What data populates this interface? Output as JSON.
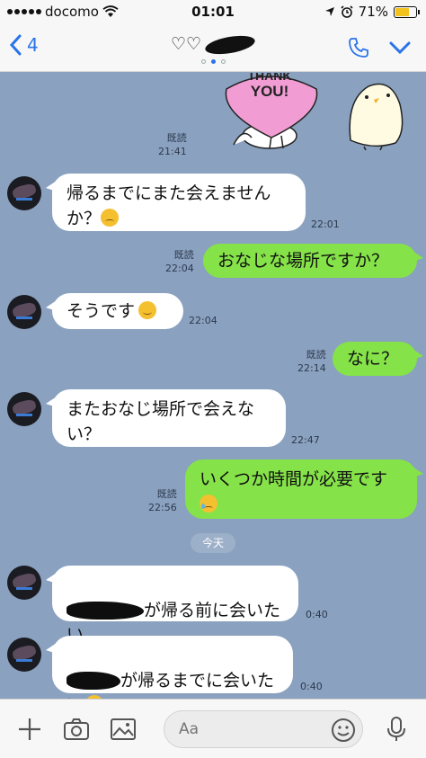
{
  "status_bar": {
    "carrier": "docomo",
    "time": "01:01",
    "battery_percent": "71%",
    "battery_level": 0.71,
    "battery_color": "#f3c21c"
  },
  "header": {
    "back_count": "4",
    "title": "♡♡",
    "page_dots": 3,
    "active_dot": 1,
    "accent_color": "#2a73e8"
  },
  "chat": {
    "background_color": "#8aa1bf",
    "sticker": {
      "read_label": "既読",
      "time": "21:41",
      "text_line1": "THANK",
      "text_line2": "YOU!"
    },
    "messages": [
      {
        "direction": "in",
        "text": "帰るまでにまた会えません\nか？",
        "emoji": "pensive-face-emoji",
        "time": "22:01"
      },
      {
        "direction": "out",
        "text": "おなじな場所ですか？",
        "read": "既読",
        "time": "22:04"
      },
      {
        "direction": "in",
        "text": "そうです",
        "emoji": "smiling-face-emoji",
        "time": "22:04"
      },
      {
        "direction": "out",
        "text": "なに？",
        "read": "既読",
        "time": "22:14"
      },
      {
        "direction": "in",
        "text": "またおなじ場所で会えな\nい？",
        "time": "22:47"
      },
      {
        "direction": "out",
        "text": "いくつか時間が必要です",
        "emoji": "crying-face-emoji",
        "read": "既読",
        "time": "22:56"
      },
      {
        "direction": "in",
        "text": "が帰る前に会いたい",
        "redacted": true,
        "time": "0:40"
      },
      {
        "direction": "in",
        "text": "が帰るまでに会いた\nい",
        "redacted": true,
        "emoji": "flushed-face-emoji",
        "time": "0:40"
      }
    ],
    "date_divider": "今天",
    "outgoing_bubble_color": "#85e249"
  },
  "input_bar": {
    "placeholder": "Aa"
  }
}
